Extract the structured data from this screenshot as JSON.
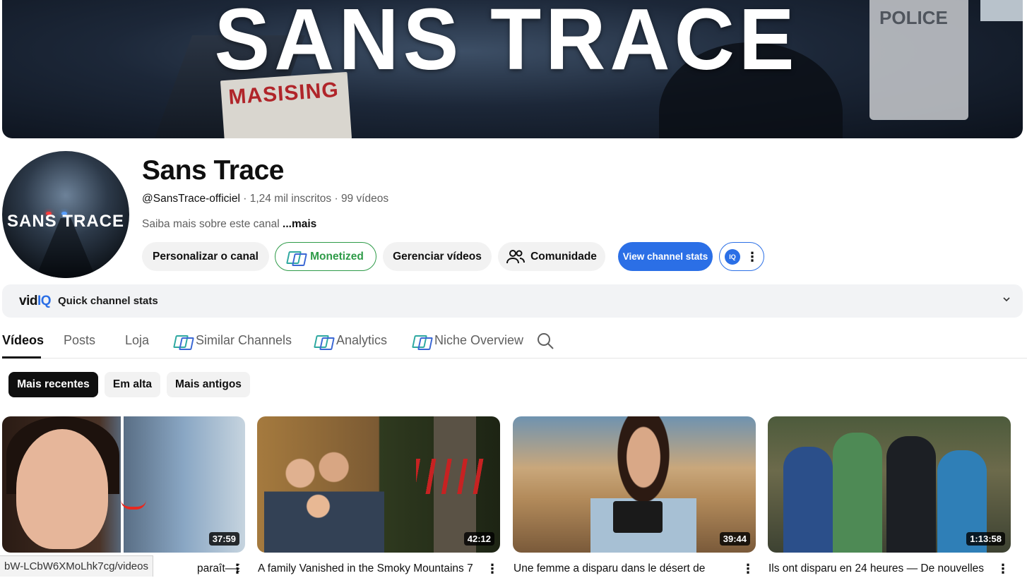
{
  "banner": {
    "title": "SANS TRACE",
    "poster_text": "MASISING",
    "police_text": "POLICE"
  },
  "channel": {
    "avatar_text": "SANS TRACE",
    "name": "Sans Trace",
    "handle": "@SansTrace-officiel",
    "separator": " · ",
    "subscribers": "1,24 mil inscritos",
    "videos_count": "99 vídeos",
    "about": "Saiba mais sobre este canal ",
    "about_more": "...mais"
  },
  "buttons": {
    "personalize": "Personalizar o canal",
    "monetized": "Monetized",
    "manage": "Gerenciar vídeos",
    "community": "Comunidade",
    "stats": "View channel stats",
    "iq_badge": "IQ"
  },
  "vidiq": {
    "logo_vid": "vid",
    "logo_iq": "IQ",
    "title": "Quick channel stats"
  },
  "tabs": [
    {
      "label": "Vídeos",
      "active": true
    },
    {
      "label": "Posts"
    },
    {
      "label": "Loja"
    },
    {
      "label": "Similar Channels",
      "icon": "nexlev-icon"
    },
    {
      "label": "Analytics",
      "icon": "nexlev-icon"
    },
    {
      "label": "Niche Overview",
      "icon": "nexlev-icon"
    }
  ],
  "chips": [
    {
      "label": "Mais recentes",
      "selected": true
    },
    {
      "label": "Em alta"
    },
    {
      "label": "Mais antigos"
    }
  ],
  "videos": [
    {
      "title": "paraît—29",
      "duration": "37:59"
    },
    {
      "title": "A family Vanished in the Smoky Mountains 7",
      "duration": "42:12"
    },
    {
      "title": "Une femme a disparu dans le désert de",
      "duration": "39:44"
    },
    {
      "title": "Ils ont disparu en 24 heures — De nouvelles",
      "duration": "1:13:58"
    }
  ],
  "status_url": "bW-LCbW6XMoLhk7cg/videos",
  "colors": {
    "accent_blue": "#2b6fe6",
    "monetized_green": "#2e9b48",
    "text": "#0f0f0f",
    "muted": "#606060"
  }
}
